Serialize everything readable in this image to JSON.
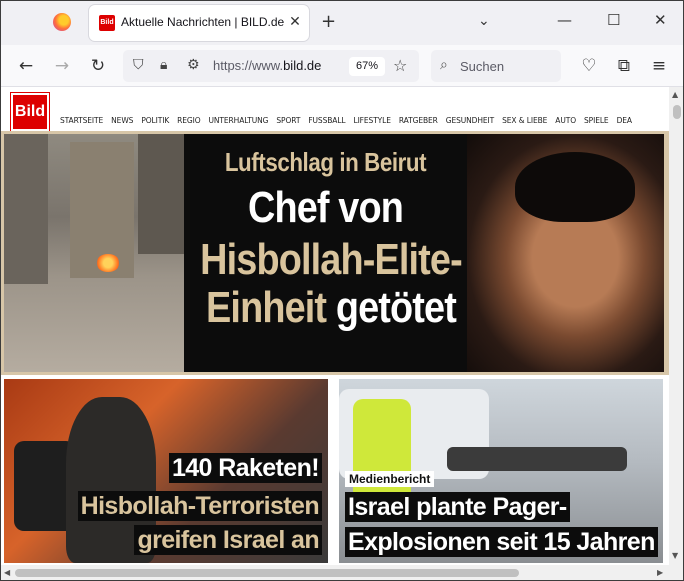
{
  "browser": {
    "tab_title": "Aktuelle Nachrichten | BILD.de",
    "tab_favicon": "Bild",
    "tab_close": "✕",
    "new_tab": "+",
    "tab_list": "⌄",
    "minimize": "—",
    "maximize": "☐",
    "close": "✕",
    "url_prefix": "https://www.",
    "url_domain": "bild.de",
    "zoom": "67%",
    "search_placeholder": "Suchen"
  },
  "site": {
    "logo_text": "Bild",
    "accent_color": "#dd0000",
    "nav": [
      "STARTSEITE",
      "NEWS",
      "POLITIK",
      "REGIO",
      "UNTERHALTUNG",
      "SPORT",
      "FUSSBALL",
      "LIFESTYLE",
      "RATGEBER",
      "GESUNDHEIT",
      "SEX & LIEBE",
      "AUTO",
      "SPIELE",
      "DEA"
    ]
  },
  "hero": {
    "kicker": "Luftschlag in Beirut",
    "line1": "Chef von",
    "line2": "Hisbollah-Elite-",
    "line3_a": "Einheit",
    "line3_b": "getötet"
  },
  "cards": [
    {
      "line1": "140 Raketen!",
      "line2": "Hisbollah-Terroristen",
      "line3": "greifen Israel an"
    },
    {
      "tag": "Medienbericht",
      "line1": "Israel plante Pager-",
      "line2": "Explosionen seit 15 Jahren"
    }
  ]
}
